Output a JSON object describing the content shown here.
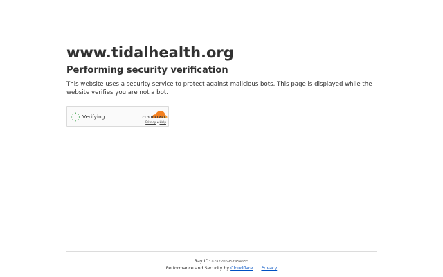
{
  "site": {
    "domain": "www.tidalhealth.org",
    "heading": "Performing security verification",
    "description": "This website uses a security service to protect against malicious bots. This page is displayed while the website verifies you are not a bot."
  },
  "widget": {
    "status": "Verifying...",
    "brand": "CLOUDFLARE",
    "privacy_link": "Privacy",
    "link_separator": "•",
    "help_link": "Help",
    "spinner_icon": "spinner-icon",
    "brand_color": "#f38020"
  },
  "footer": {
    "ray_label": "Ray ID:",
    "ray_id": "a2af20695fa54655",
    "performance_text": "Performance and Security by",
    "cloudflare_link": "Cloudflare",
    "separator": "|",
    "privacy_link": "Privacy",
    "link_color": "#0051c3"
  }
}
